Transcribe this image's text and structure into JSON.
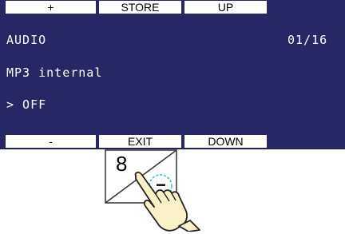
{
  "softkeys_top": {
    "key1": "+",
    "key2": "STORE",
    "key3": "UP"
  },
  "display": {
    "menu_title": "AUDIO",
    "page_indicator": "01/16",
    "source_name": "MP3 internal",
    "value_line": "> OFF"
  },
  "softkeys_bottom": {
    "key1": "-",
    "key2": "EXIT",
    "key3": "DOWN"
  },
  "keypad": {
    "number_label": "8",
    "minus_label": "−",
    "icons": {
      "press": "pointing-hand-icon"
    }
  },
  "colors": {
    "screen_background": "#272766",
    "screen_text": "#ffffff",
    "softkey_background": "#ffffff",
    "press_circle": "#49b7d8",
    "hand_fill": "#fbf1c7"
  }
}
